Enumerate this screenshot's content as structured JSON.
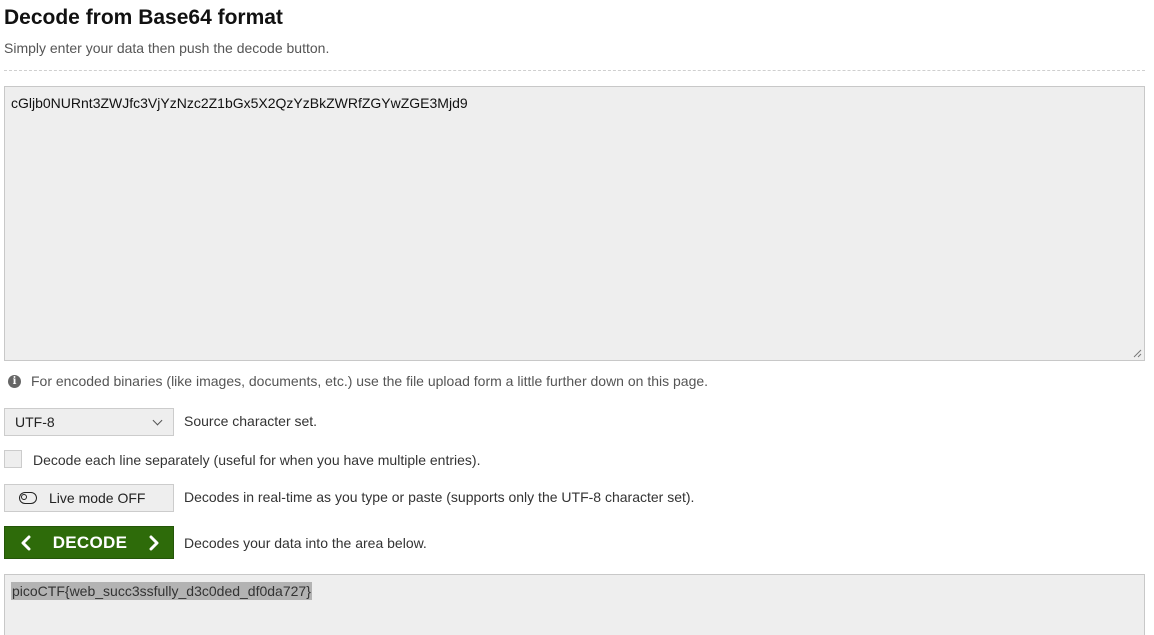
{
  "header": {
    "title": "Decode from Base64 format",
    "subtitle": "Simply enter your data then push the decode button."
  },
  "input": {
    "value": "cGljb0NURnt3ZWJfc3VjYzNzc2Z1bGx5X2QzYzBkZWRfZGYwZGE3Mjd9"
  },
  "info": {
    "icon": "info-icon",
    "text": "For encoded binaries (like images, documents, etc.) use the file upload form a little further down on this page."
  },
  "charset": {
    "selected": "UTF-8",
    "label": "Source character set."
  },
  "split_lines": {
    "checked": false,
    "label": "Decode each line separately (useful for when you have multiple entries)."
  },
  "live_mode": {
    "icon": "toggle-off-icon",
    "label": "Live mode OFF",
    "description": "Decodes in real-time as you type or paste (supports only the UTF-8 character set)."
  },
  "decode": {
    "label": "DECODE",
    "description": "Decodes your data into the area below.",
    "color": "#2e6b0a"
  },
  "output": {
    "value": "picoCTF{web_succ3ssfully_d3c0ded_df0da727}"
  }
}
